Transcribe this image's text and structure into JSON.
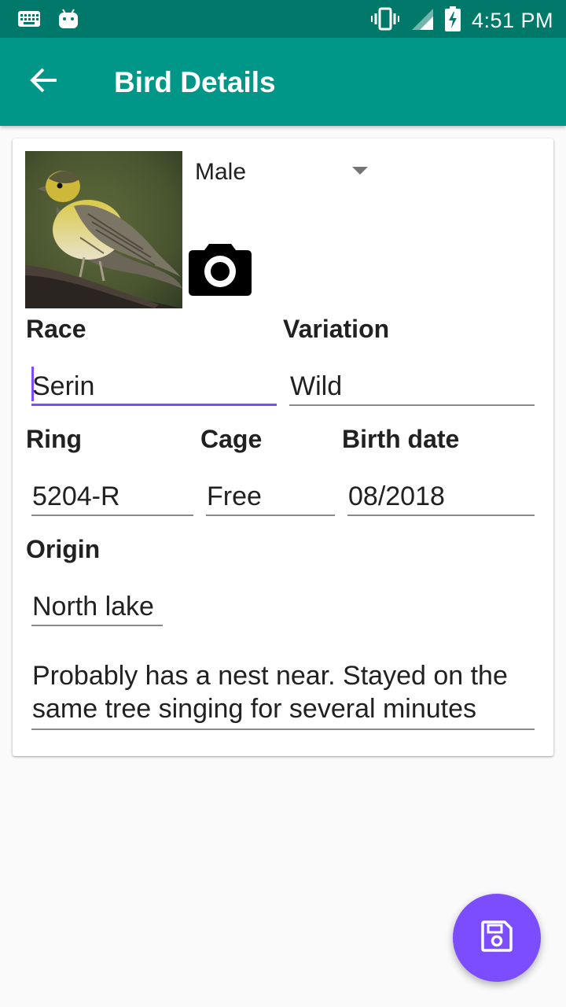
{
  "status_bar": {
    "time": "4:51 PM",
    "icons": [
      "keyboard-icon",
      "android-icon",
      "vibrate-icon",
      "signal-icon",
      "battery-charging-icon"
    ]
  },
  "app_bar": {
    "title": "Bird Details",
    "back_icon": "arrow-back-icon"
  },
  "bird": {
    "photo_icon": "bird-photo",
    "camera_icon": "camera-icon",
    "sex": {
      "selected": "Male"
    },
    "race": {
      "label": "Race",
      "value": "Serin"
    },
    "variation": {
      "label": "Variation",
      "value": "Wild"
    },
    "ring": {
      "label": "Ring",
      "value": "5204-R"
    },
    "cage": {
      "label": "Cage",
      "value": "Free"
    },
    "birth_date": {
      "label": "Birth date",
      "value": "08/2018"
    },
    "origin": {
      "label": "Origin",
      "value": "North lake"
    },
    "notes": {
      "value": "Probably has a nest near. Stayed on the same tree singing for several minutes"
    }
  },
  "fab": {
    "icon": "save-icon"
  },
  "colors": {
    "status_bar": "#00796b",
    "app_bar": "#009688",
    "accent": "#7c4dff",
    "background": "#fafafa"
  }
}
